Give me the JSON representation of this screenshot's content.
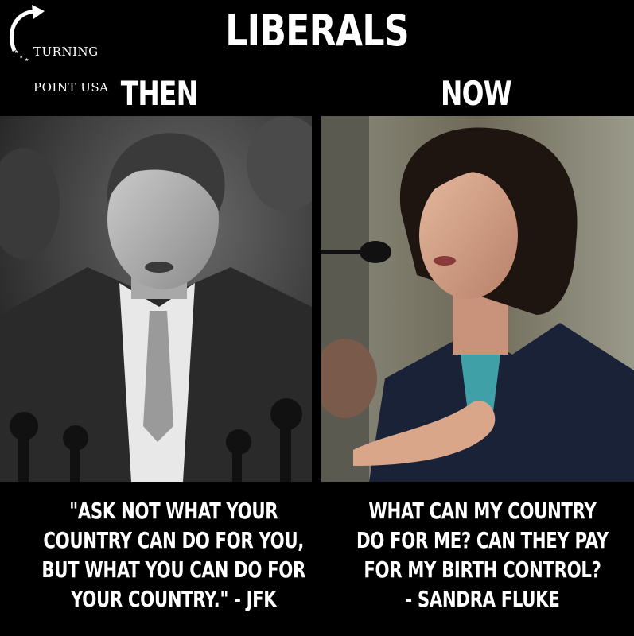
{
  "logo": {
    "line1": "TURNING",
    "line2": "POINT USA"
  },
  "title": "LIBERALS",
  "columns": {
    "left": {
      "label": "THEN",
      "quote_lines": [
        "\"ASK NOT WHAT YOUR",
        "COUNTRY CAN DO FOR YOU,",
        "BUT WHAT YOU CAN DO FOR",
        "YOUR COUNTRY.\" - JFK"
      ]
    },
    "right": {
      "label": "NOW",
      "quote_lines": [
        "WHAT CAN MY COUNTRY",
        "DO FOR ME? CAN THEY PAY",
        "FOR MY BIRTH CONTROL?",
        "- SANDRA FLUKE"
      ]
    }
  },
  "colors": {
    "background": "#000000",
    "text": "#ffffff",
    "suit_navy": "#1a2238",
    "skin": "#d9a68a",
    "hair_dark": "#1e1410"
  }
}
